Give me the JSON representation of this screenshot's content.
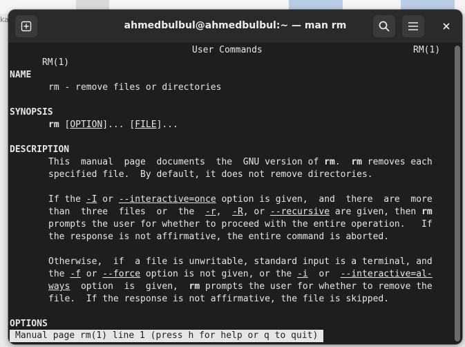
{
  "window": {
    "title": "ahmedbulbul@ahmedbulbul:~ — man rm"
  },
  "background": {
    "left_fragment": "ka"
  },
  "colors": {
    "terminal_bg": "#1e1e1e",
    "titlebar_bg": "#2a2a2a",
    "text": "#e6e6e6"
  },
  "icons": [
    "new-tab-icon",
    "search-icon",
    "hamburger-menu-icon",
    "close-icon"
  ],
  "man": {
    "header_left": "RM(1)",
    "header_center": "User Commands",
    "header_right": "RM(1)",
    "name_heading": "NAME",
    "name_text": "rm - remove files or directories",
    "synopsis_heading": "SYNOPSIS",
    "synopsis_cmd": "rm",
    "synopsis_option": "OPTION",
    "synopsis_file": "FILE",
    "description_heading": "DESCRIPTION",
    "desc": {
      "l1a": "This  manual  page  documents  the  GNU version of ",
      "rm": "rm",
      "l1b": ".  ",
      "l1c": " removes each",
      "l2": "specified file.  By default, it does not remove directories.",
      "l3a": "If the ",
      "opt_I": "-I",
      "l3b": " or ",
      "opt_interactive_once": "--interactive=once",
      "l3c": " option is given,  and  there  are  more",
      "l4a": "than  three  files  or  the  ",
      "opt_r": "-r",
      "l4b": ",  ",
      "opt_R": "-R",
      "l4c": ", or ",
      "opt_recursive": "--recursive",
      "l4d": " are given, then ",
      "l5": "prompts the user for whether to proceed with the entire operation.   If",
      "l6": "the response is not affirmative, the entire command is aborted.",
      "l7": "Otherwise,  if  a file is unwritable, standard input is a terminal, and",
      "l8a": "the ",
      "opt_f": "-f",
      "l8b": " or ",
      "opt_force": "--force",
      "l8c": " option is not given, or the ",
      "opt_i": "-i",
      "l8d": "  or  ",
      "opt_interactive_al": "--interactive=al-",
      "opt_ways": "ways",
      "l9a": "  option  is  given,  ",
      "l9b": " prompts the user for whether to remove the",
      "l10": "file.  If the response is not affirmative, the file is skipped."
    },
    "options_heading": "OPTIONS"
  },
  "status_bar": {
    "text": "Manual page rm(1) line 1 (press h for help or q to quit)"
  }
}
